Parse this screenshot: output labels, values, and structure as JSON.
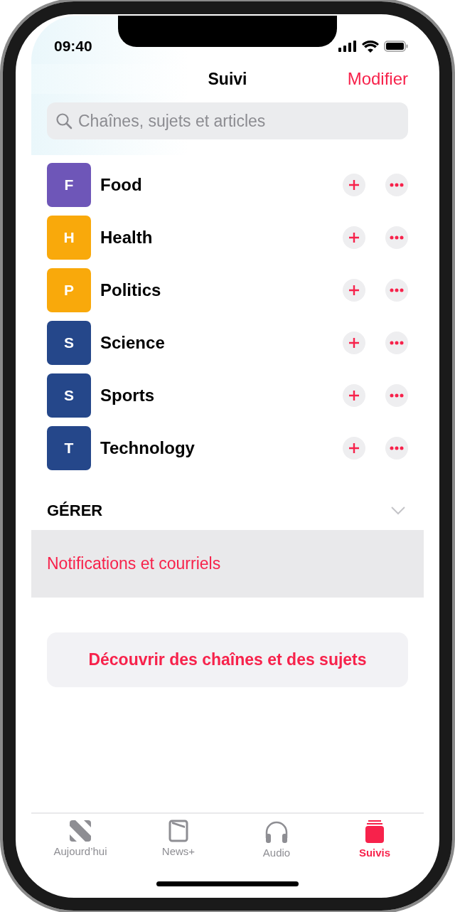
{
  "status_bar": {
    "time": "09:40"
  },
  "nav": {
    "title": "Suivi",
    "action": "Modifier"
  },
  "search": {
    "placeholder": "Chaînes, sujets et articles"
  },
  "channels": [
    {
      "letter": "F",
      "name": "Food",
      "color": "#6e56b8"
    },
    {
      "letter": "H",
      "name": "Health",
      "color": "#f9a90b"
    },
    {
      "letter": "P",
      "name": "Politics",
      "color": "#f9a90b"
    },
    {
      "letter": "S",
      "name": "Science",
      "color": "#25478a"
    },
    {
      "letter": "S",
      "name": "Sports",
      "color": "#25478a"
    },
    {
      "letter": "T",
      "name": "Technology",
      "color": "#25478a"
    }
  ],
  "manage": {
    "title": "GÉRER",
    "expanded": true,
    "items": [
      "Notifications et courriels"
    ]
  },
  "discover_button": "Découvrir des chaînes et des sujets",
  "tabs": [
    {
      "label": "Aujourd’hui",
      "kind": "today",
      "selected": false
    },
    {
      "label": "News+",
      "kind": "newsplus",
      "selected": false
    },
    {
      "label": "Audio",
      "kind": "audio",
      "selected": false
    },
    {
      "label": "Suivis",
      "kind": "following",
      "selected": true
    }
  ]
}
